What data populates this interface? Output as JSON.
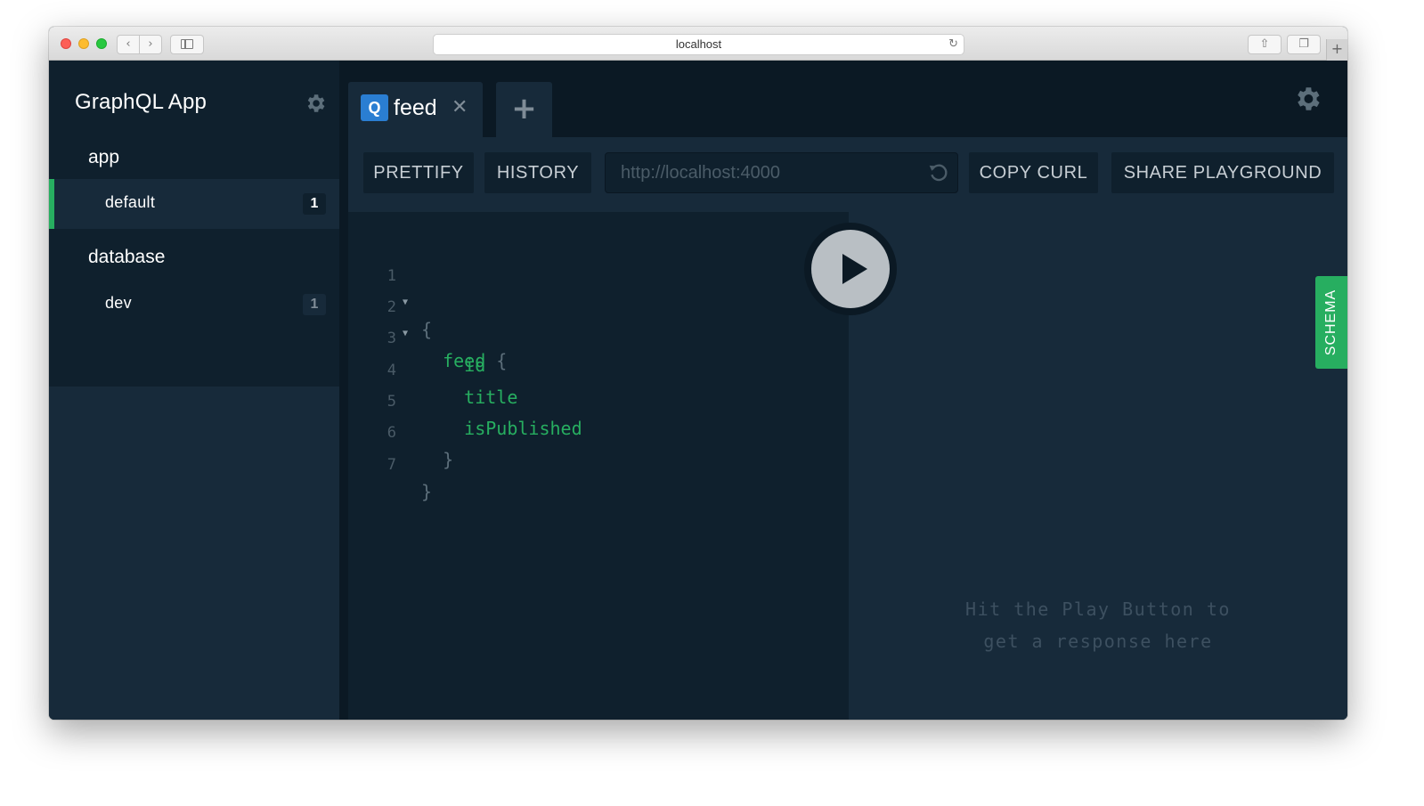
{
  "browser": {
    "address": "localhost"
  },
  "sidebar": {
    "title": "GraphQL App",
    "groups": [
      {
        "label": "app",
        "items": [
          {
            "label": "default",
            "count": "1",
            "active": true
          }
        ]
      },
      {
        "label": "database",
        "items": [
          {
            "label": "dev",
            "count": "1",
            "active": false
          }
        ]
      }
    ]
  },
  "tabs": [
    {
      "badge": "Q",
      "name": "feed"
    }
  ],
  "toolbar": {
    "prettify_label": "PRETTIFY",
    "history_label": "HISTORY",
    "endpoint_value": "http://localhost:4000",
    "copy_curl_label": "COPY CURL",
    "share_label": "SHARE PLAYGROUND"
  },
  "editor": {
    "lines": [
      {
        "n": "1",
        "text": "{",
        "fold": true
      },
      {
        "n": "2",
        "text": "  feed {",
        "fold": true
      },
      {
        "n": "3",
        "text": "    id",
        "fold": false
      },
      {
        "n": "4",
        "text": "    title",
        "fold": false
      },
      {
        "n": "5",
        "text": "    isPublished",
        "fold": false
      },
      {
        "n": "6",
        "text": "  }",
        "fold": false
      },
      {
        "n": "7",
        "text": "}",
        "fold": false
      }
    ]
  },
  "result": {
    "hint_line1": "Hit the Play Button to",
    "hint_line2": "get a response here"
  },
  "schema_label": "SCHEMA",
  "icons": {
    "settings": "gear-icon",
    "close_tab": "close-icon",
    "new_tab": "plus-icon",
    "run": "play-icon",
    "reset_endpoint": "reset-icon"
  },
  "colors": {
    "accent_green": "#27ae60",
    "query_badge_blue": "#2a7ed2",
    "background": "#0f202d",
    "panel": "#172a3a"
  }
}
